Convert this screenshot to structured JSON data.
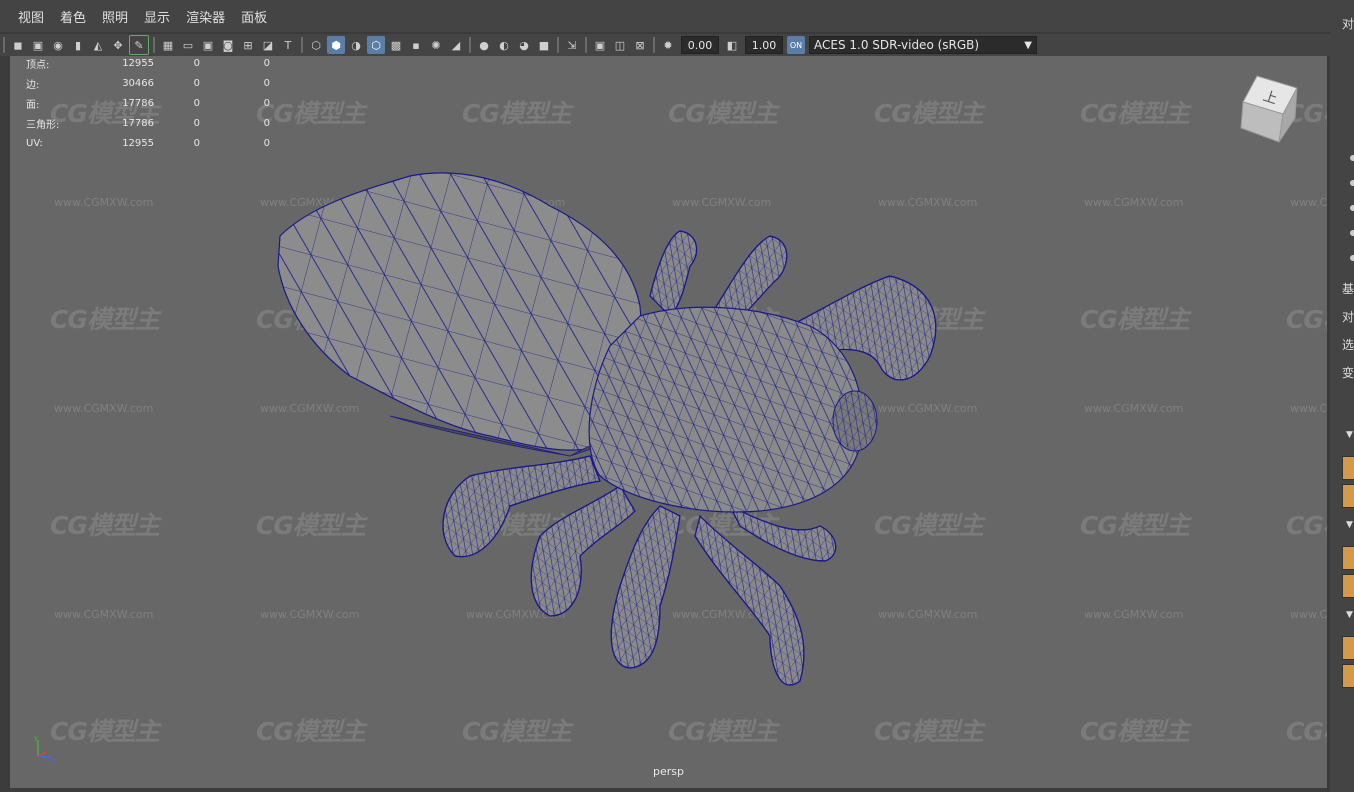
{
  "menu": [
    "视图",
    "着色",
    "照明",
    "显示",
    "渲染器",
    "面板"
  ],
  "toolbar": {
    "exposure": "0.00",
    "gamma": "1.00",
    "colorspace": "ACES 1.0 SDR-video (sRGB)",
    "icons": [
      "camera-select-icon",
      "camera-lock-icon",
      "camera-attr-icon",
      "bookmark-icon",
      "image-plane-icon",
      "2d-pan-icon",
      "grease-pencil-icon",
      "grid-icon",
      "film-gate-icon",
      "resolution-gate-icon",
      "gate-mask-icon",
      "field-chart-icon",
      "safe-action-icon",
      "safe-title-icon",
      "wireframe-icon",
      "smooth-shade-icon",
      "default-material-icon",
      "wireframe-on-shaded-icon",
      "xray-icon",
      "textured-icon",
      "lights-icon",
      "shadows-icon",
      "ambient-occlusion-icon",
      "motion-blur-icon",
      "anti-alias-icon",
      "depth-of-field-icon",
      "isolate-select-icon",
      "xray-joints-icon",
      "xray-active-icon",
      "backface-icon",
      "exposure-icon",
      "gamma-icon",
      "color-mgmt-icon"
    ]
  },
  "hud": {
    "rows": [
      {
        "label": "顶点:",
        "v1": "12955",
        "v2": "0",
        "v3": "0"
      },
      {
        "label": "边:",
        "v1": "30466",
        "v2": "0",
        "v3": "0"
      },
      {
        "label": "面:",
        "v1": "17786",
        "v2": "0",
        "v3": "0"
      },
      {
        "label": "三角形:",
        "v1": "17786",
        "v2": "0",
        "v3": "0"
      },
      {
        "label": "UV:",
        "v1": "12955",
        "v2": "0",
        "v3": "0"
      }
    ]
  },
  "viewcube": {
    "face": "上"
  },
  "camera_label": "persp",
  "watermark": {
    "logo": "CG模型主",
    "url": "www.CGMXW.com"
  },
  "right_panel": {
    "labels": [
      "对",
      "基",
      "对",
      "选",
      "变"
    ]
  },
  "colors": {
    "wire": "#1a1a8c",
    "viewport_bg": "#676767",
    "mesh_gray": "#8a8a8a"
  }
}
